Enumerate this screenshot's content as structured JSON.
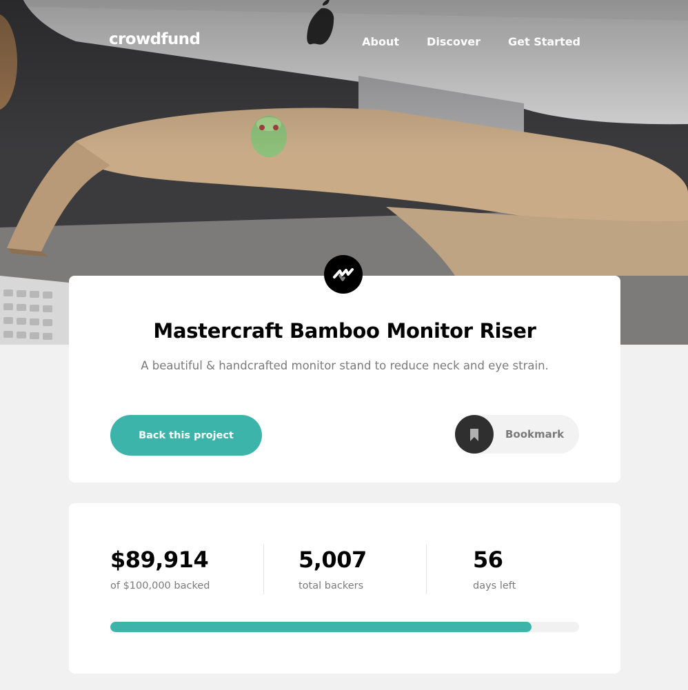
{
  "header": {
    "logo": "crowdfund",
    "nav": [
      "About",
      "Discover",
      "Get Started"
    ]
  },
  "project": {
    "title": "Mastercraft Bamboo Monitor Riser",
    "subtitle": "A beautiful & handcrafted monitor stand to reduce neck and eye strain.",
    "back_label": "Back this project",
    "bookmark_label": "Bookmark"
  },
  "stats": {
    "backed_value": "$89,914",
    "backed_label": "of $100,000 backed",
    "backers_value": "5,007",
    "backers_label": "total backers",
    "days_value": "56",
    "days_label": "days left",
    "progress_percent": 89.914
  },
  "colors": {
    "accent": "#3cb4a9",
    "dark": "#2f2f2f",
    "muted_text": "#7a7a7a"
  },
  "icons": {
    "brand_logo": "mastercraft-logo-icon",
    "bookmark": "bookmark-icon"
  }
}
